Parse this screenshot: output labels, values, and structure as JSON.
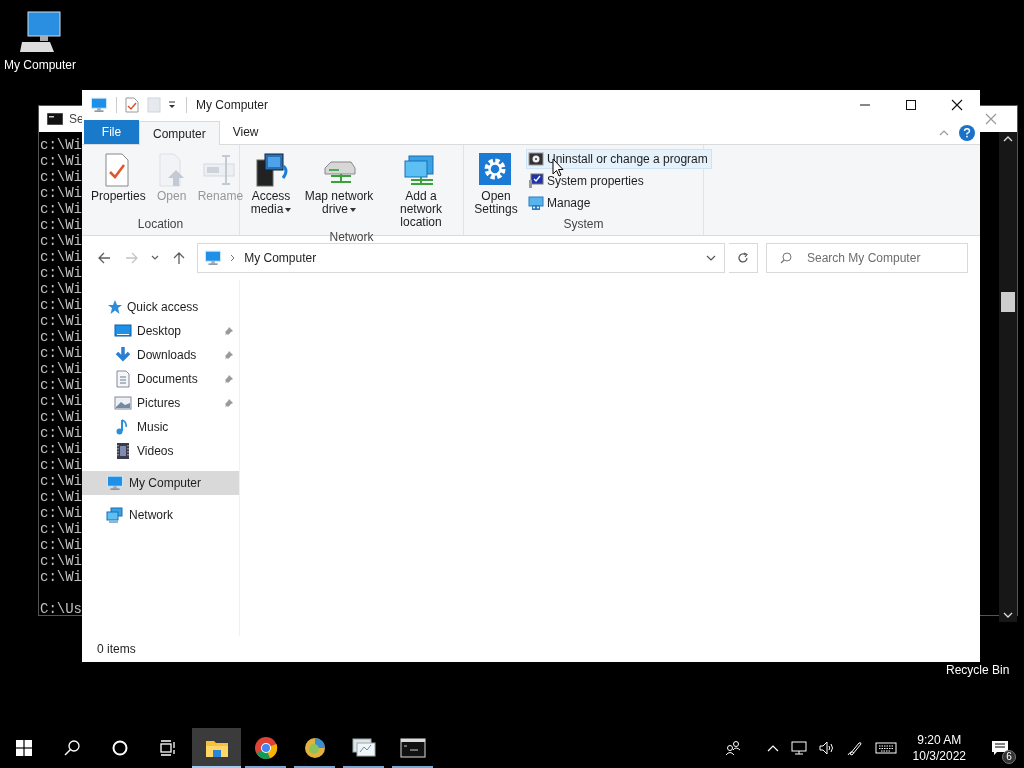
{
  "desktop_icons": [
    {
      "label": "My Computer"
    },
    {
      "label": "Recycle Bin"
    }
  ],
  "console": {
    "title": "Se",
    "lines": [
      "c:\\Wi",
      "c:\\Wi",
      "c:\\Wi",
      "c:\\Wi",
      "c:\\Wi",
      "c:\\Wi",
      "c:\\Wi",
      "c:\\Wi",
      "c:\\Wi",
      "c:\\Wi",
      "c:\\Wi",
      "c:\\Wi",
      "c:\\Wi",
      "c:\\Wi",
      "c:\\Wi",
      "c:\\Wi",
      "c:\\Wi",
      "c:\\Wi",
      "c:\\Wi",
      "c:\\Wi",
      "c:\\Wi",
      "c:\\Wi",
      "c:\\Wi",
      "c:\\Wi",
      "c:\\Wi",
      "c:\\Wi",
      "c:\\Wi",
      "c:\\Wi"
    ],
    "prompt": "C:\\Us"
  },
  "explorer": {
    "title": "My Computer",
    "tabs": [
      {
        "label": "File",
        "kind": "menu",
        "selected": false
      },
      {
        "label": "Computer",
        "kind": "tab",
        "selected": true
      },
      {
        "label": "View",
        "kind": "tab",
        "selected": false
      }
    ],
    "ribbon": [
      {
        "label": "Location",
        "buttons": [
          {
            "label": "Properties",
            "kind": "large",
            "disabled": false,
            "dropdown": false,
            "hovered": false
          },
          {
            "label": "Open",
            "kind": "large",
            "disabled": true,
            "dropdown": false,
            "hovered": false
          },
          {
            "label": "Rename",
            "kind": "large",
            "disabled": true,
            "dropdown": false,
            "hovered": false
          }
        ]
      },
      {
        "label": "Network",
        "buttons": [
          {
            "label": "Access media",
            "kind": "large",
            "disabled": false,
            "dropdown": true,
            "hovered": false
          },
          {
            "label": "Map network drive",
            "kind": "large",
            "disabled": false,
            "dropdown": true,
            "hovered": false
          },
          {
            "label": "Add a network location",
            "kind": "large",
            "disabled": false,
            "dropdown": false,
            "hovered": false
          }
        ]
      },
      {
        "label": "System",
        "buttons": [
          {
            "label": "Open Settings",
            "kind": "large",
            "disabled": false,
            "dropdown": false,
            "hovered": false
          },
          {
            "label": "Uninstall or change a program",
            "kind": "small",
            "disabled": false,
            "dropdown": false,
            "hovered": true
          },
          {
            "label": "System properties",
            "kind": "small",
            "disabled": false,
            "dropdown": false,
            "hovered": false
          },
          {
            "label": "Manage",
            "kind": "small",
            "disabled": false,
            "dropdown": false,
            "hovered": false
          }
        ]
      }
    ],
    "nav_buttons": [
      {
        "kind": "back",
        "disabled": false
      },
      {
        "kind": "forward",
        "disabled": true
      },
      {
        "kind": "recent",
        "disabled": false
      },
      {
        "kind": "up",
        "disabled": false
      }
    ],
    "address": {
      "path": "My Computer"
    },
    "search": {
      "placeholder": "Search My Computer"
    },
    "nav_pane": [
      {
        "label": "Quick access",
        "selected": false,
        "children": [
          {
            "label": "Desktop",
            "pinned": true,
            "selected": false
          },
          {
            "label": "Downloads",
            "pinned": true,
            "selected": false
          },
          {
            "label": "Documents",
            "pinned": true,
            "selected": false
          },
          {
            "label": "Pictures",
            "pinned": true,
            "selected": false
          },
          {
            "label": "Music",
            "pinned": false,
            "selected": false
          },
          {
            "label": "Videos",
            "pinned": false,
            "selected": false
          }
        ]
      },
      {
        "label": "My Computer",
        "selected": true
      },
      {
        "label": "Network",
        "selected": false
      }
    ],
    "status_bar": "0 items"
  },
  "taskbar": {
    "apps": [
      {
        "kind": "explorer",
        "active": true,
        "running": true
      },
      {
        "kind": "chrome",
        "active": false,
        "running": true
      },
      {
        "kind": "globe",
        "active": false,
        "running": true
      },
      {
        "kind": "monitor",
        "active": false,
        "running": true
      },
      {
        "kind": "console",
        "active": false,
        "running": true
      }
    ],
    "clock": {
      "time": "9:20 AM",
      "date": "10/3/2022"
    },
    "notifications": "6"
  }
}
